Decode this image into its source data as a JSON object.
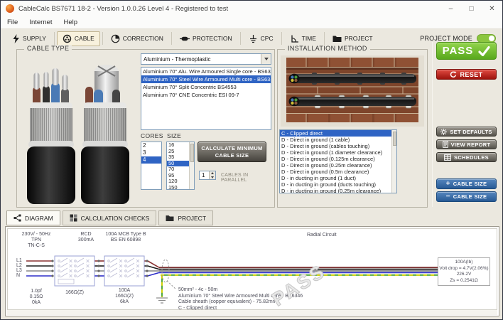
{
  "window": {
    "title": "CableCalc BS7671 18-2 - Version 1.0.0.26 Level 4 - Registered to test",
    "menu": [
      "File",
      "Internet",
      "Help"
    ],
    "controls": {
      "minimize": "–",
      "maximize": "□",
      "close": "✕"
    }
  },
  "toolbar": {
    "tabs": [
      {
        "label": "SUPPLY"
      },
      {
        "label": "CABLE",
        "active": true
      },
      {
        "label": "CORRECTION"
      },
      {
        "label": "PROTECTION"
      },
      {
        "label": "CPC"
      },
      {
        "label": "TIME"
      },
      {
        "label": "PROJECT"
      }
    ],
    "project_mode_label": "PROJECT MODE",
    "project_mode_on": true
  },
  "cable_type": {
    "group_label": "CABLE TYPE",
    "family_selected": "Aluminium - Thermoplastic",
    "type_options": [
      "Aluminium 70° Alu. Wire Armoured Single core - BS6346",
      "Aluminium 70° Steel Wire Armoured Multi core - BS6346",
      "Aluminium 70° Split Concentric BS4553",
      "Aluminium 70° CNE Concentric ESI 09-7"
    ],
    "type_selected_index": 1,
    "cores_label": "CORES",
    "cores_options": [
      "2",
      "3",
      "4"
    ],
    "cores_selected": "4",
    "size_label": "SIZE",
    "size_options": [
      "16",
      "25",
      "35",
      "50",
      "70",
      "95",
      "120",
      "150"
    ],
    "size_selected": "50",
    "calc_line1": "CALCULATE MINIMUM",
    "calc_line2": "CABLE SIZE",
    "parallel_value": "1",
    "parallel_label": "CABLES IN PARALLEL"
  },
  "installation": {
    "group_label": "INSTALLATION METHOD",
    "options": [
      "C - Clipped direct",
      "D - Direct in ground (1 cable)",
      "D - Direct in ground (cables touching)",
      "D - Direct in ground (1 diameter clearance)",
      "D - Direct in ground (0.125m clearance)",
      "D - Direct in ground (0.25m clearance)",
      "D - Direct in ground (0.5m clearance)",
      "D - in ducting in ground (1 duct)",
      "D - in ducting in ground (ducts touching)",
      "D - in ducting in ground (0.25m clearance)"
    ],
    "selected_index": 0
  },
  "actions": {
    "pass": "PASS",
    "reset": "RESET",
    "set_defaults": "SET DEFAULTS",
    "view_report": "VIEW REPORT",
    "schedules": "SCHEDULES",
    "cable_size": "CABLE SIZE",
    "plus": "+",
    "minus": "−"
  },
  "bottom_tabs": [
    {
      "label": "DIAGRAM",
      "active": true
    },
    {
      "label": "CALCULATION CHECKS"
    },
    {
      "label": "PROJECT"
    }
  ],
  "diagram": {
    "supply_line1": "230V/ - 50Hz",
    "supply_line2": "TPN",
    "supply_line3": "TN-C-S",
    "rcd_line1": "RCD",
    "rcd_line2": "300mA",
    "rcd_below": "166Ω(Z)",
    "mcb_line1": "100A MCB Type B",
    "mcb_line2": "BS EN 60898",
    "mcb_below1": "100A",
    "mcb_below2": "166Ω(Z)",
    "mcb_below3": "6kA",
    "phase1": "L1",
    "phase2": "L2",
    "phase3": "L3",
    "phase4": "N",
    "supply_val1": "1.0pf",
    "supply_val2": "0.15Ω",
    "supply_val3": "0kA",
    "circuit_label": "Radial Circuit",
    "note1": "50mm² - 4c - 50m",
    "note2": "Aluminium 70° Steel Wire Armoured Multi core - BS6346",
    "note3": "Cable sheath (copper equivalent) - 75.82mm²",
    "note4": "C - Clipped direct",
    "load1": "100A(Ib)",
    "load2": "Volt drop = 4.7V(2.06%)",
    "load3": "226.2V",
    "load4": "Zs = 0.2541Ω",
    "watermark": "PASS"
  },
  "colors": {
    "pass_green": "#6db52c",
    "reset_red": "#c22520",
    "action_gray": "#66625a",
    "action_blue": "#2f63a4",
    "selection_blue": "#2f64c4",
    "toggle_green": "#8bc63f"
  }
}
